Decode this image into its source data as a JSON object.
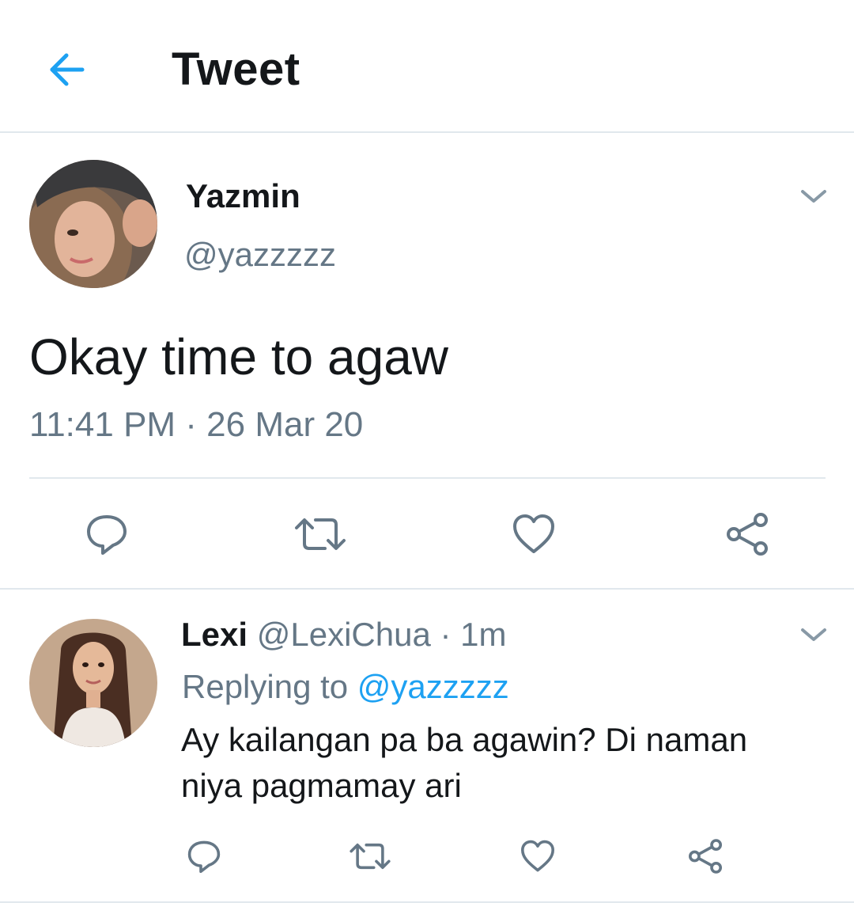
{
  "header": {
    "title": "Tweet",
    "back_icon": "arrow-left-icon",
    "accent_color": "#1da1f2"
  },
  "main_tweet": {
    "name": "Yazmin",
    "handle": "@yazzzzz",
    "text": "Okay time to agaw",
    "timestamp": "11:41 PM · 26 Mar 20",
    "actions": [
      "reply-icon",
      "retweet-icon",
      "like-icon",
      "share-icon"
    ]
  },
  "reply_tweet": {
    "name": "Lexi",
    "handle": "@LexiChua",
    "time": "· 1m",
    "replying_label": "Replying to",
    "replying_handle": "@yazzzzz",
    "text": "Ay kailangan pa ba agawin? Di naman niya pagmamay ari",
    "actions": [
      "reply-icon",
      "retweet-icon",
      "like-icon",
      "share-icon"
    ]
  },
  "colors": {
    "text_primary": "#14171a",
    "text_secondary": "#657786",
    "link": "#1da1f2",
    "divider": "#e1e8ed"
  }
}
